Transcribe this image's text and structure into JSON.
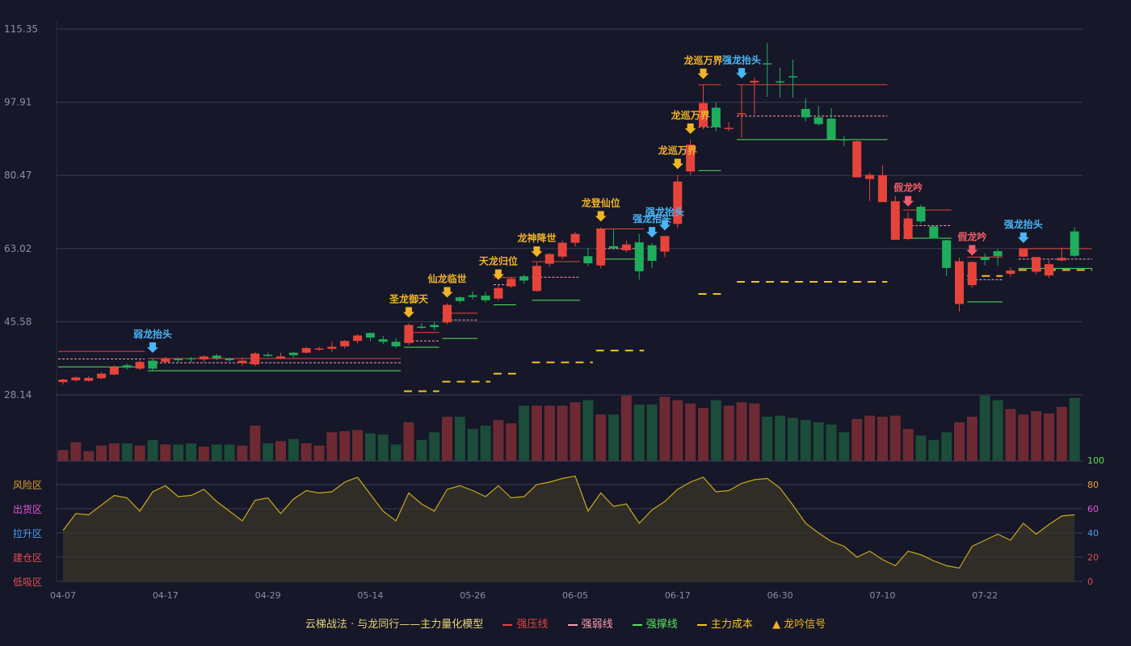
{
  "chart_data": {
    "type": "candlestick",
    "y_ticks": [
      "115.35",
      "97.91",
      "80.47",
      "63.02",
      "45.58",
      "28.14"
    ],
    "x_tick_labels": [
      "04-07",
      "04-17",
      "04-29",
      "05-14",
      "05-26",
      "06-05",
      "06-17",
      "06-30",
      "07-10",
      "07-22"
    ],
    "x_tick_index": [
      0,
      8,
      16,
      24,
      32,
      40,
      48,
      56,
      64,
      72
    ],
    "ylim": [
      28.14,
      115.35
    ],
    "candles": [
      [
        31.2,
        32,
        30.6,
        31.8
      ],
      [
        31.6,
        32.5,
        31.3,
        32.3
      ],
      [
        32.2,
        32.6,
        31.3,
        31.5
      ],
      [
        32.1,
        33.5,
        31.9,
        33.2
      ],
      [
        33.0,
        35.2,
        32.8,
        34.8
      ],
      [
        34.6,
        35.6,
        34.2,
        35.2
      ],
      [
        36.0,
        36.4,
        34.0,
        34.4
      ],
      [
        34.4,
        36.8,
        34.0,
        36.3
      ],
      [
        36.0,
        37.2,
        35.8,
        36.8
      ],
      [
        36.4,
        37.0,
        36.0,
        36.7
      ],
      [
        36.6,
        37.2,
        35.8,
        36.9
      ],
      [
        36.6,
        37.6,
        36.0,
        37.3
      ],
      [
        37.5,
        37.9,
        36.4,
        36.9
      ],
      [
        36.8,
        37.0,
        36.2,
        36.4
      ],
      [
        36.3,
        37.1,
        35.1,
        35.7
      ],
      [
        35.4,
        38.4,
        35.0,
        38.0
      ],
      [
        37.6,
        38.2,
        37.2,
        37.7
      ],
      [
        37.3,
        38.2,
        36.6,
        36.9
      ],
      [
        37.6,
        38.4,
        37.0,
        38.2
      ],
      [
        38.2,
        39.6,
        38.0,
        39.3
      ],
      [
        39.0,
        39.6,
        38.6,
        39.2
      ],
      [
        39.1,
        40.8,
        38.4,
        39.6
      ],
      [
        39.7,
        41.2,
        39.2,
        41.0
      ],
      [
        41.0,
        42.6,
        40.4,
        42.3
      ],
      [
        41.8,
        43.0,
        41.0,
        42.9
      ],
      [
        41.4,
        42.2,
        40.2,
        40.8
      ],
      [
        40.8,
        41.6,
        39.3,
        39.7
      ],
      [
        40.5,
        45.2,
        40.0,
        44.8
      ],
      [
        44.3,
        45.2,
        43.9,
        44.4
      ],
      [
        44.8,
        45.6,
        43.6,
        44.3
      ],
      [
        45.4,
        50.0,
        45.0,
        49.6
      ],
      [
        50.5,
        51.6,
        50.0,
        51.4
      ],
      [
        51.9,
        52.8,
        50.9,
        51.5
      ],
      [
        51.8,
        52.7,
        50.1,
        50.7
      ],
      [
        51.1,
        54.2,
        50.6,
        53.6
      ],
      [
        54.0,
        56.3,
        53.6,
        55.8
      ],
      [
        55.4,
        56.8,
        54.6,
        56.4
      ],
      [
        58.9,
        59.7,
        52.7,
        52.9
      ],
      [
        61.7,
        62.0,
        58.7,
        59.4
      ],
      [
        61.1,
        64.9,
        60.5,
        64.4
      ],
      [
        64.4,
        67.0,
        63.5,
        66.5
      ],
      [
        61.2,
        63.2,
        58.8,
        59.5
      ],
      [
        59.0,
        68.1,
        58.3,
        67.7
      ],
      [
        63.6,
        67.6,
        62.8,
        63.1
      ],
      [
        62.6,
        64.9,
        62.1,
        64.0
      ],
      [
        64.5,
        66.5,
        55.6,
        57.6
      ],
      [
        63.8,
        64.3,
        58.3,
        60.1
      ],
      [
        62.3,
        66.0,
        61.0,
        66.0
      ],
      [
        79.0,
        80.6,
        67.9,
        68.9
      ],
      [
        87.8,
        89.0,
        80.6,
        81.4
      ],
      [
        97.7,
        102.1,
        91.4,
        92.1
      ],
      [
        96.6,
        97.9,
        91.0,
        92.0
      ],
      [
        91.8,
        93.2,
        91.0,
        91.7
      ],
      [
        95.2,
        102.2,
        89.4,
        95.3
      ],
      [
        102.6,
        103.8,
        95.0,
        103.0
      ],
      [
        107.2,
        112.0,
        99.2,
        107.0
      ],
      [
        102.9,
        106.2,
        99.0,
        102.7
      ],
      [
        103.9,
        108.1,
        99.0,
        104.1
      ],
      [
        96.3,
        98.9,
        93.3,
        94.3
      ],
      [
        94.3,
        97.0,
        92.3,
        92.7
      ],
      [
        94.0,
        96.5,
        91.4,
        89.1
      ],
      [
        89.1,
        89.9,
        87.4,
        88.9
      ],
      [
        88.6,
        88.8,
        84.9,
        80.0
      ],
      [
        80.6,
        81.1,
        74.4,
        79.6
      ],
      [
        80.5,
        82.9,
        74.8,
        74.1
      ],
      [
        74.3,
        75.6,
        74.0,
        65.1
      ],
      [
        65.3,
        71.7,
        65.0,
        70.2
      ],
      [
        69.5,
        73.5,
        69.0,
        73.0
      ],
      [
        68.3,
        68.5,
        66.0,
        65.4
      ],
      [
        65.0,
        65.1,
        56.5,
        58.4
      ],
      [
        60.0,
        60.9,
        48.0,
        49.8
      ],
      [
        54.3,
        60.0,
        53.7,
        59.8
      ],
      [
        60.3,
        61.9,
        59.0,
        61.0
      ],
      [
        62.4,
        62.9,
        58.9,
        61.2
      ],
      [
        57.0,
        58.6,
        56.2,
        57.8
      ],
      [
        61.1,
        63.0,
        61.0,
        62.9
      ],
      [
        57.5,
        60.8,
        56.9,
        61.0
      ],
      [
        56.6,
        60.3,
        56.0,
        59.3
      ],
      [
        60.8,
        63.3,
        60.0,
        60.2
      ],
      [
        61.3,
        68.1,
        61.0,
        67.1
      ]
    ],
    "dirs": [
      1,
      1,
      1,
      1,
      1,
      0,
      1,
      0,
      1,
      0,
      0,
      1,
      0,
      0,
      1,
      1,
      0,
      1,
      0,
      1,
      1,
      1,
      1,
      1,
      0,
      0,
      0,
      1,
      0,
      0,
      1,
      0,
      0,
      0,
      1,
      1,
      0,
      1,
      1,
      1,
      1,
      0,
      1,
      0,
      1,
      0,
      0,
      1,
      1,
      1,
      1,
      0,
      1,
      1,
      1,
      0,
      0,
      0,
      0,
      0,
      0,
      0,
      1,
      1,
      1,
      1,
      1,
      0,
      0,
      0,
      1,
      1,
      0,
      0,
      1,
      1,
      1,
      1,
      1,
      0
    ],
    "volume": [
      10,
      17,
      9,
      14,
      16,
      16,
      14,
      19,
      15,
      15,
      16,
      13,
      15,
      15,
      14,
      32,
      16,
      18,
      20,
      16,
      14,
      26,
      27,
      28,
      25,
      24,
      15,
      35,
      19,
      26,
      40,
      40,
      29,
      32,
      37,
      34,
      50,
      50,
      50,
      50,
      53,
      55,
      42,
      42,
      59,
      51,
      51,
      58,
      55,
      52,
      48,
      55,
      50,
      53,
      52,
      40,
      41,
      39,
      37,
      35,
      33,
      26,
      38,
      41,
      40,
      41,
      29,
      23,
      19,
      26,
      35,
      40,
      59,
      55,
      47,
      42,
      45,
      43,
      49,
      57
    ],
    "indicator": [
      42,
      56,
      55,
      63,
      71,
      69,
      58,
      74,
      79,
      70,
      71,
      76,
      66,
      58,
      50,
      67,
      69,
      56,
      68,
      75,
      73,
      74,
      82,
      86,
      72,
      58,
      50,
      73,
      64,
      58,
      76,
      79,
      75,
      70,
      79,
      69,
      70,
      80,
      82,
      85,
      87,
      58,
      73,
      62,
      64,
      48,
      59,
      66,
      76,
      82,
      86,
      74,
      75,
      81,
      84,
      85,
      77,
      63,
      48,
      40,
      33,
      29,
      20,
      25,
      18,
      13,
      25,
      22,
      17,
      13,
      11,
      29,
      34,
      39,
      34,
      48,
      39,
      47,
      54,
      55
    ],
    "indicator_ticks": [
      "100",
      "80",
      "60",
      "40",
      "20",
      "0"
    ],
    "indicator_zones": [
      "风险区",
      "出货区",
      "拉升区",
      "建仓区",
      "低吸区"
    ],
    "signals": [
      {
        "i": 7,
        "text": "弱龙抬头",
        "kind": "blue"
      },
      {
        "i": 27,
        "text": "圣龙御天",
        "kind": "gold"
      },
      {
        "i": 30,
        "text": "仙龙临世",
        "kind": "gold"
      },
      {
        "i": 34,
        "text": "天龙归位",
        "kind": "gold"
      },
      {
        "i": 37,
        "text": "龙神降世",
        "kind": "gold"
      },
      {
        "i": 42,
        "text": "龙登仙位",
        "kind": "gold"
      },
      {
        "i": 46,
        "text": "强龙抬头",
        "kind": "blue"
      },
      {
        "i": 47,
        "text": "强龙抬头",
        "kind": "blue"
      },
      {
        "i": 48,
        "text": "龙巡万界",
        "kind": "gold"
      },
      {
        "i": 49,
        "text": "龙巡万界",
        "kind": "gold"
      },
      {
        "i": 50,
        "text": "龙巡万界",
        "kind": "gold"
      },
      {
        "i": 53,
        "text": "强龙抬头",
        "kind": "blue"
      },
      {
        "i": 66,
        "text": "假龙吟",
        "kind": "red"
      },
      {
        "i": 71,
        "text": "假龙吟",
        "kind": "red"
      },
      {
        "i": 75,
        "text": "强龙抬头",
        "kind": "blue"
      }
    ],
    "support_resistance": [
      {
        "from": 0,
        "to": 6,
        "press": 38.5,
        "weak": 36.7,
        "hold": 34.8
      },
      {
        "from": 7,
        "to": 26,
        "press": 36.8,
        "weak": 35.8,
        "hold": 33.9
      },
      {
        "from": 27,
        "to": 29,
        "press": 43.0,
        "weak": 41.0,
        "hold": 39.5
      },
      {
        "from": 30,
        "to": 32,
        "press": 47.6,
        "weak": 46.0,
        "hold": 41.6
      },
      {
        "from": 34,
        "to": 35,
        "press": 56.1,
        "weak": 54.4,
        "hold": 49.6
      },
      {
        "from": 37,
        "to": 40,
        "press": 59.9,
        "weak": 56.2,
        "hold": 50.7
      },
      {
        "from": 42,
        "to": 45,
        "press": 67.7,
        "weak": 63.0,
        "hold": 60.5
      },
      {
        "from": 50,
        "to": 51,
        "press": 102.1,
        "weak": 92.0,
        "hold": 81.6
      },
      {
        "from": 53,
        "to": 64,
        "press": 102.1,
        "weak": 94.6,
        "hold": 89.0
      },
      {
        "from": 66,
        "to": 69,
        "press": 72.2,
        "weak": 68.5,
        "hold": 65.5
      },
      {
        "from": 71,
        "to": 73,
        "press": 61.0,
        "weak": 55.6,
        "hold": 50.3
      },
      {
        "from": 75,
        "to": 80,
        "press": 63.0,
        "weak": 60.5,
        "hold": 58.3
      }
    ],
    "main_cost": [
      {
        "from": 27,
        "to": 29,
        "v": 29.0
      },
      {
        "from": 30,
        "to": 33,
        "v": 31.3
      },
      {
        "from": 34,
        "to": 35,
        "v": 33.2
      },
      {
        "from": 37,
        "to": 41,
        "v": 35.9
      },
      {
        "from": 42,
        "to": 45,
        "v": 38.7
      },
      {
        "from": 50,
        "to": 51,
        "v": 52.2
      },
      {
        "from": 53,
        "to": 64,
        "v": 55.1
      },
      {
        "from": 71,
        "to": 73,
        "v": 56.5
      },
      {
        "from": 75,
        "to": 80,
        "v": 57.9
      }
    ]
  },
  "legend": {
    "title": "云梯战法 · 与龙同行——主力量化模型",
    "items": [
      {
        "label": "强压线",
        "color": "#e6443b",
        "style": "solid"
      },
      {
        "label": "强弱线",
        "color": "#ff9fb0",
        "style": "dashed"
      },
      {
        "label": "强撑线",
        "color": "#57e35d",
        "style": "solid"
      },
      {
        "label": "主力成本",
        "color": "#f3c02b",
        "style": "dashed"
      },
      {
        "label": "龙吟信号",
        "color": "#f0b429",
        "style": "triangle"
      }
    ]
  },
  "colors": {
    "up": "#e6443b",
    "down": "#1fae5b",
    "grid": "#3a3c55",
    "text": "#8c8fa8",
    "gold": "#f0b429",
    "blue": "#49b6f5",
    "red_signal": "#f05c6a",
    "indicator_line": "#c8a918",
    "volume_up": "#6e2a33",
    "volume_down": "#1b4d3a"
  }
}
